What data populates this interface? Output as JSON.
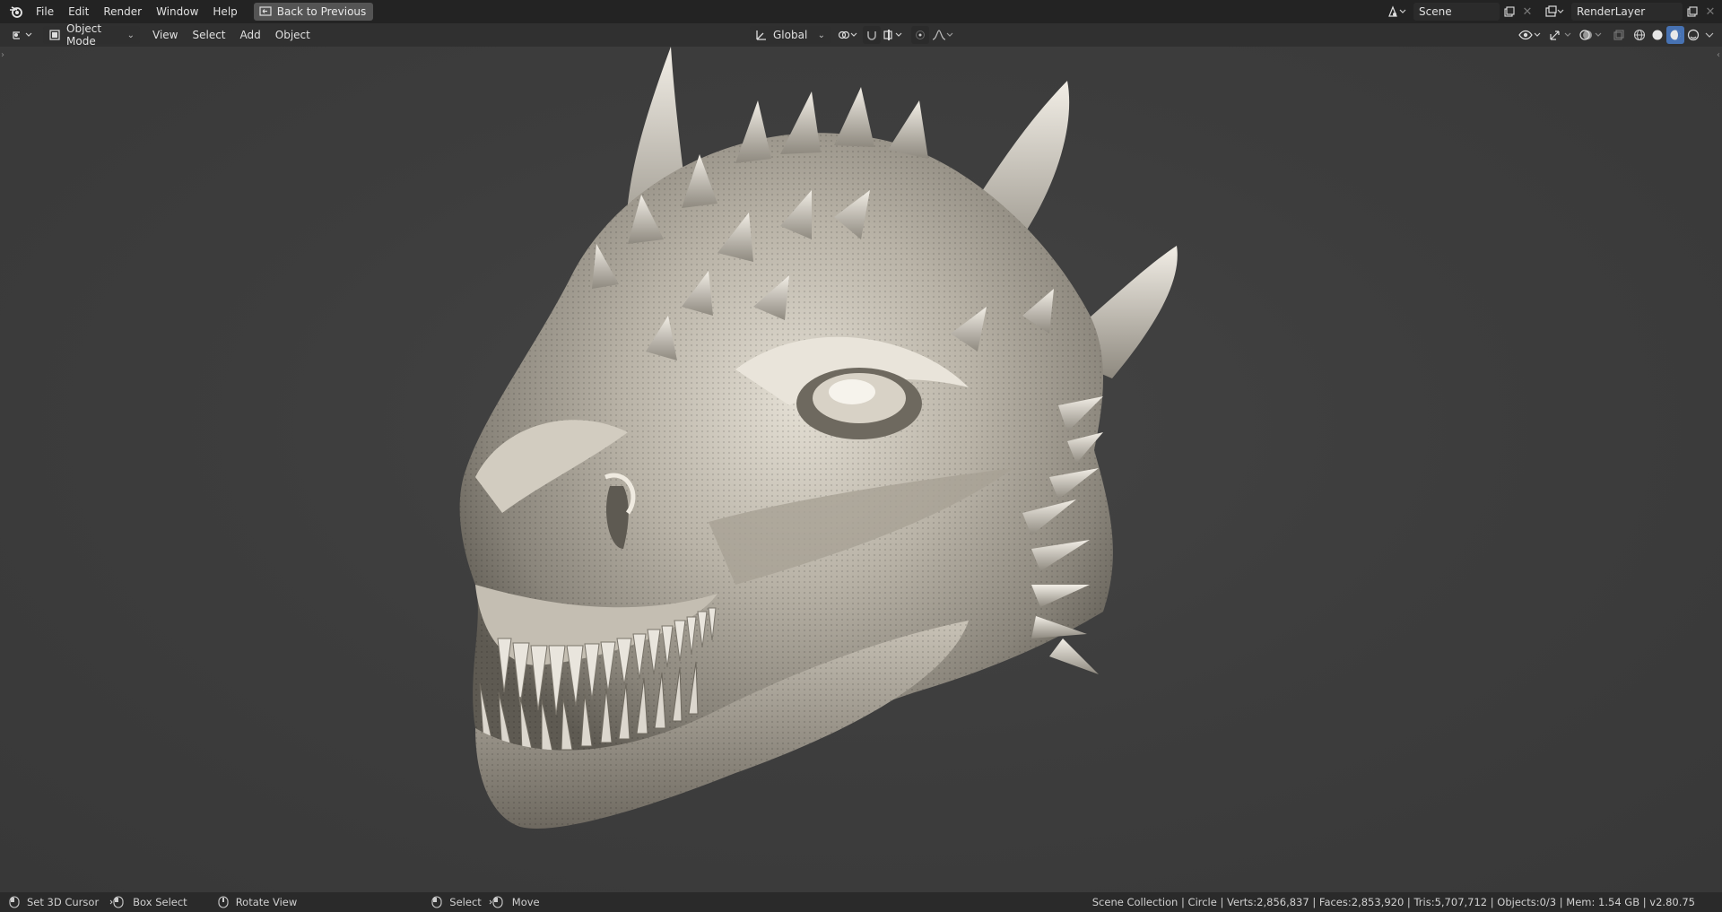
{
  "app": {
    "name": "Blender",
    "logo_icon": "blender-logo-icon"
  },
  "topbar": {
    "menu": [
      "File",
      "Edit",
      "Render",
      "Window",
      "Help"
    ],
    "back_button": "Back to Previous",
    "scene": {
      "value": "Scene"
    },
    "render_layer": {
      "value": "RenderLayer"
    }
  },
  "header": {
    "mode": "Object Mode",
    "menu": [
      "View",
      "Select",
      "Add",
      "Object"
    ],
    "orientation": "Global"
  },
  "viewport": {
    "object": "dragon head sculpt",
    "colors": {
      "background": "#3d3d3d",
      "model": "#b8b2a6",
      "highlight": "#f0ece2",
      "shadow": "#5e5a52"
    }
  },
  "statusbar": {
    "hints": [
      "Set 3D Cursor",
      "Box Select",
      "Rotate View",
      "Select",
      "Move"
    ],
    "stats": "Scene Collection | Circle | Verts:2,856,837 | Faces:2,853,920 | Tris:5,707,712 | Objects:0/3 | Mem: 1.54 GB | v2.80.75"
  }
}
